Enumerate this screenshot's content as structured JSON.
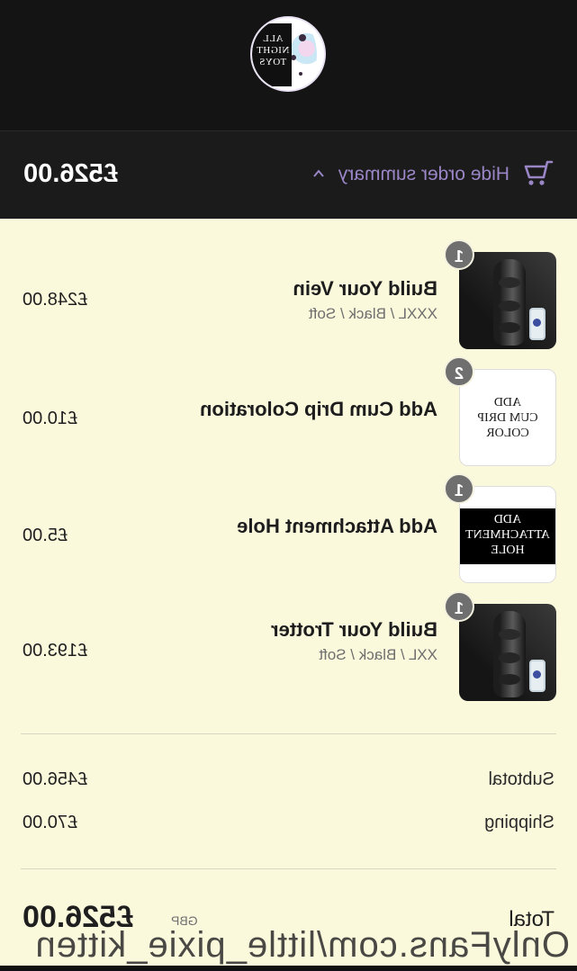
{
  "brand": {
    "logo_lines": [
      "ALL",
      "NIGHT",
      "TOYS"
    ]
  },
  "summary_bar": {
    "toggle_label": "Hide order summary",
    "total": "£526.00",
    "icon": "cart-icon",
    "toggle_color": "#9a86c6"
  },
  "items": [
    {
      "quantity": "1",
      "name": "Build Your Vein",
      "variant": "XXXL / Black / Soft",
      "price": "£248.00",
      "thumb_label": []
    },
    {
      "quantity": "2",
      "name": "Add Cum Drip Coloration",
      "variant": "",
      "price": "£10.00",
      "thumb_label": [
        "ADD",
        "CUM DRIP",
        "COLOR"
      ]
    },
    {
      "quantity": "1",
      "name": "Add Attachment Hole",
      "variant": "",
      "price": "£5.00",
      "thumb_label": [
        "ADD",
        "ATTACHMENT",
        "HOLE"
      ]
    },
    {
      "quantity": "1",
      "name": "Build Your Trotter",
      "variant": "XXL / Black / Soft",
      "price": "£193.00",
      "thumb_label": []
    }
  ],
  "totals": {
    "subtotal_label": "Subtotal",
    "subtotal": "£456.00",
    "shipping_label": "Shipping",
    "shipping": "£70.00",
    "total_label": "Total",
    "currency": "GBP",
    "total": "£526.00"
  },
  "watermark": "OnlyFans.com/little_pixie_kitten"
}
